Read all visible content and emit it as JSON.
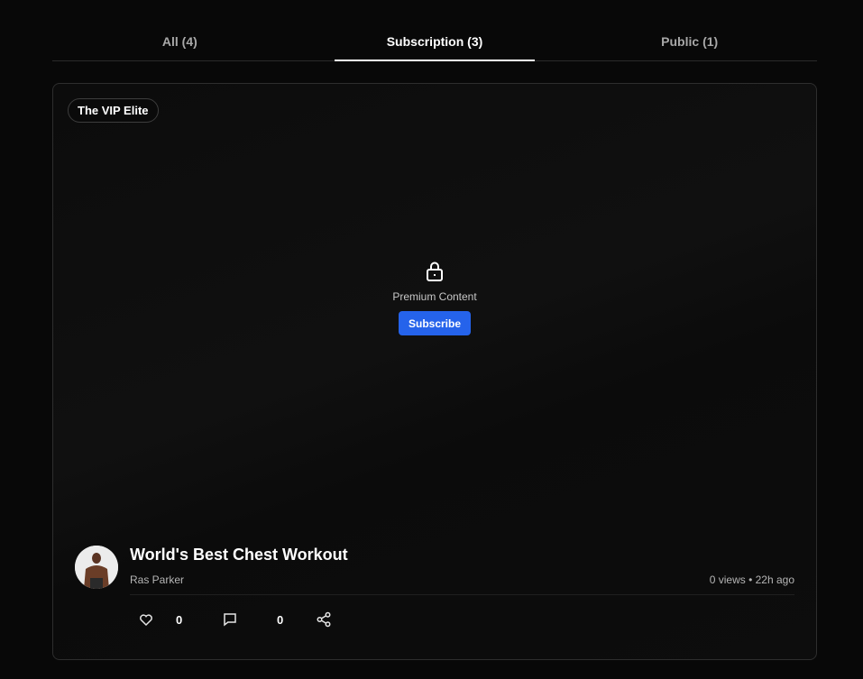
{
  "tabs": [
    {
      "label": "All (4)"
    },
    {
      "label": "Subscription (3)"
    },
    {
      "label": "Public (1)"
    }
  ],
  "active_tab": "Subscription (3)",
  "post": {
    "tier_badge": "The VIP Elite",
    "premium_label": "Premium Content",
    "subscribe_label": "Subscribe",
    "title": "World's Best Chest Workout",
    "author": "Ras Parker",
    "stats": "0 views • 22h ago",
    "likes": "0",
    "comments": "0"
  },
  "colors": {
    "background": "#080808",
    "accent": "#2563eb",
    "border": "#2e2e2e"
  },
  "icons": [
    "lock-icon",
    "heart-icon",
    "comment-icon",
    "share-icon"
  ]
}
